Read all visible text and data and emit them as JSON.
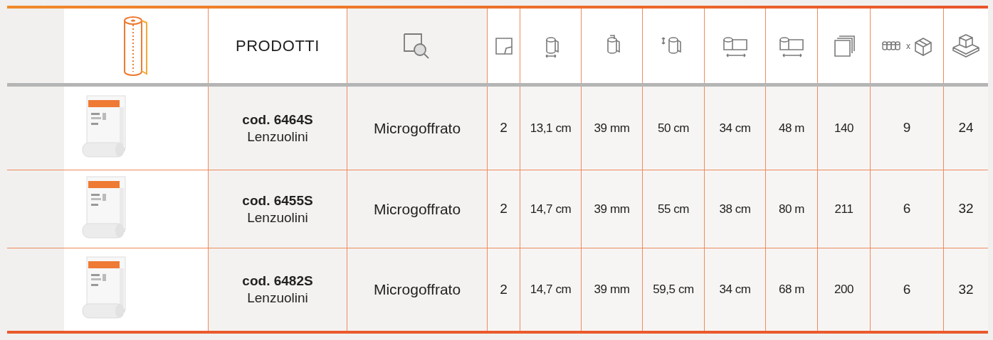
{
  "header": {
    "products_label": "PRODOTTI",
    "pack_separator": "x"
  },
  "rows": [
    {
      "code": "cod. 6464S",
      "name": "Lenzuolini",
      "material": "Microgoffrato",
      "values": [
        "2",
        "13,1 cm",
        "39 mm",
        "50 cm",
        "34 cm",
        "48 m",
        "140",
        "9",
        "24"
      ]
    },
    {
      "code": "cod. 6455S",
      "name": "Lenzuolini",
      "material": "Microgoffrato",
      "values": [
        "2",
        "14,7 cm",
        "39 mm",
        "55 cm",
        "38 cm",
        "80 m",
        "211",
        "6",
        "32"
      ]
    },
    {
      "code": "cod. 6482S",
      "name": "Lenzuolini",
      "material": "Microgoffrato",
      "values": [
        "2",
        "14,7 cm",
        "39 mm",
        "59,5 cm",
        "34 cm",
        "68 m",
        "200",
        "6",
        "32"
      ]
    }
  ]
}
